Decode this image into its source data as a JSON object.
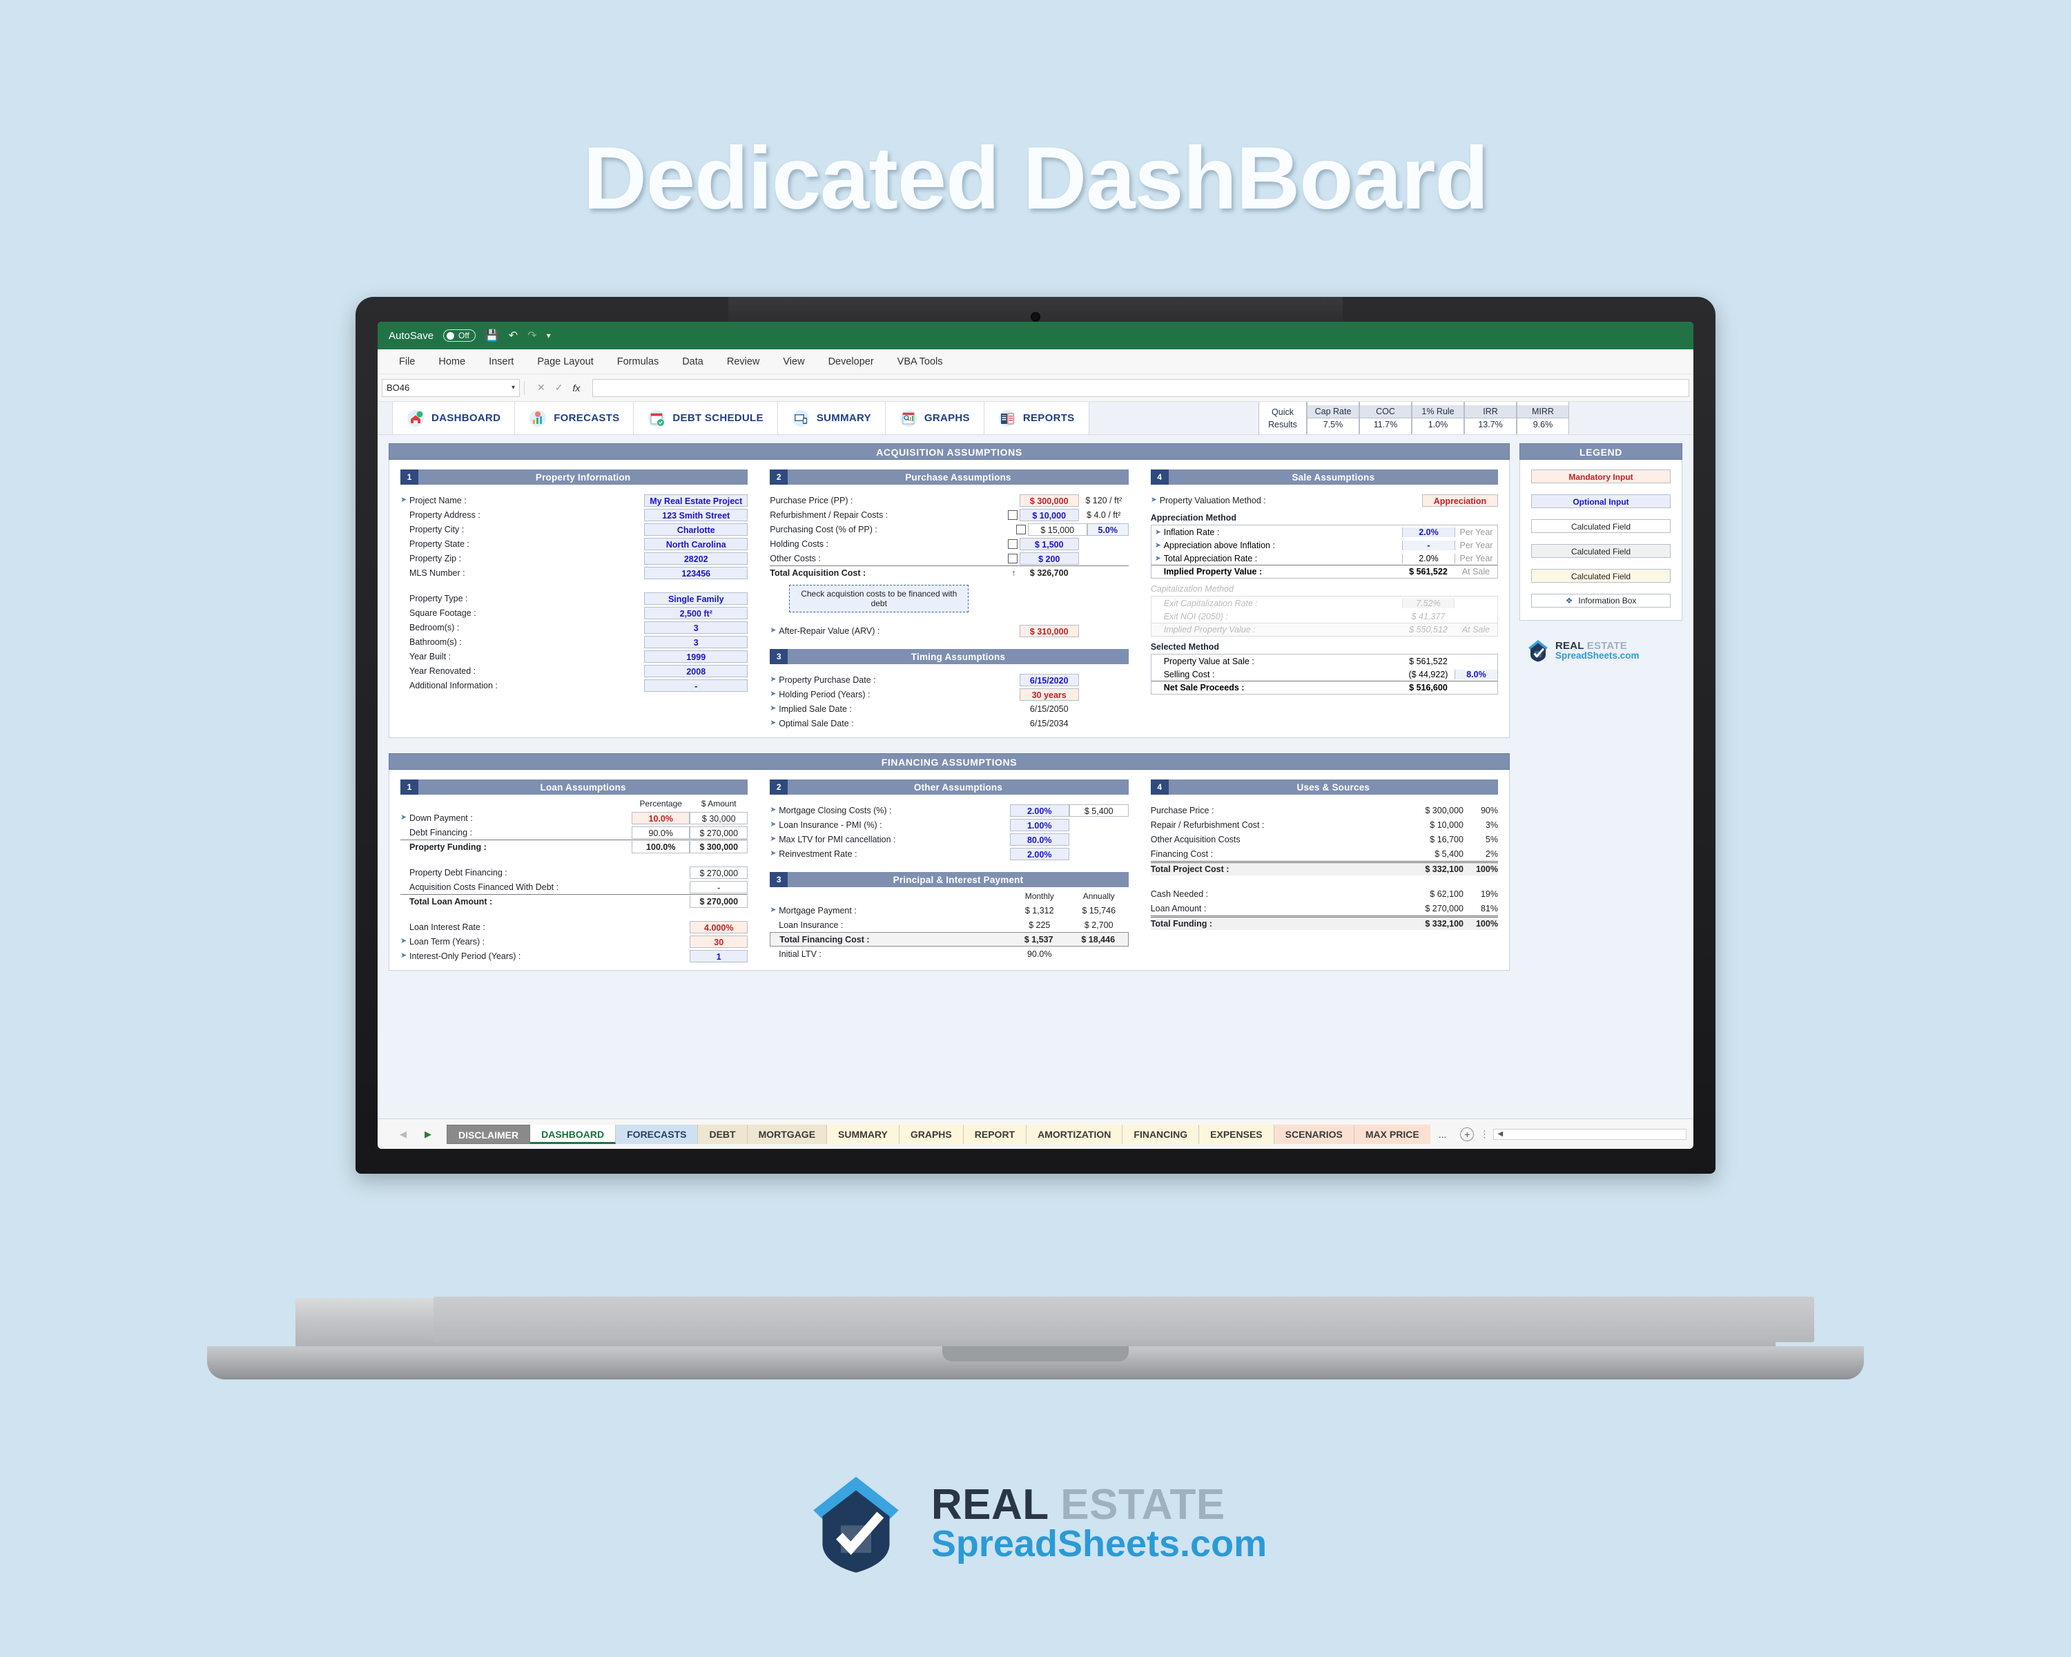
{
  "hero_title": "Dedicated DashBoard",
  "excel": {
    "autosave_label": "AutoSave",
    "autosave_state": "Off",
    "ribbon_tabs": [
      "File",
      "Home",
      "Insert",
      "Page Layout",
      "Formulas",
      "Data",
      "Review",
      "View",
      "Developer",
      "VBA Tools"
    ],
    "name_box": "BO46",
    "formula_bar": "",
    "nav_buttons": [
      {
        "label": "DASHBOARD",
        "icon": "house-chart-icon"
      },
      {
        "label": "FORECASTS",
        "icon": "bar-chart-person-icon"
      },
      {
        "label": "DEBT SCHEDULE",
        "icon": "calendar-check-icon"
      },
      {
        "label": "SUMMARY",
        "icon": "monitor-mobile-icon"
      },
      {
        "label": "GRAPHS",
        "icon": "magnify-chart-icon"
      },
      {
        "label": "REPORTS",
        "icon": "report-clipboard-icon"
      }
    ],
    "quick_results": {
      "label_line1": "Quick",
      "label_line2": "Results",
      "metrics": [
        {
          "name": "Cap Rate",
          "value": "7.5%"
        },
        {
          "name": "COC",
          "value": "11.7%"
        },
        {
          "name": "1% Rule",
          "value": "1.0%"
        },
        {
          "name": "IRR",
          "value": "13.7%"
        },
        {
          "name": "MIRR",
          "value": "9.6%"
        }
      ]
    },
    "sheet_tabs": [
      {
        "label": "DISCLAIMER",
        "style": "dis"
      },
      {
        "label": "DASHBOARD",
        "style": "active"
      },
      {
        "label": "FORECASTS",
        "style": "blue"
      },
      {
        "label": "DEBT",
        "style": "tan"
      },
      {
        "label": "MORTGAGE",
        "style": "tan"
      },
      {
        "label": "SUMMARY",
        "style": "cream"
      },
      {
        "label": "GRAPHS",
        "style": "cream"
      },
      {
        "label": "REPORT",
        "style": "cream"
      },
      {
        "label": "AMORTIZATION",
        "style": "cream"
      },
      {
        "label": "FINANCING",
        "style": "cream"
      },
      {
        "label": "EXPENSES",
        "style": "cream"
      },
      {
        "label": "SCENARIOS",
        "style": "peach"
      },
      {
        "label": "MAX PRICE",
        "style": "peach"
      }
    ],
    "tabs_more": "..."
  },
  "acquisition": {
    "band_title": "ACQUISITION ASSUMPTIONS",
    "property_information": {
      "num": "1",
      "title": "Property Information",
      "rows": [
        {
          "label": "Project Name :",
          "value": "My Real Estate Project",
          "style": "opt",
          "bullet": true
        },
        {
          "label": "Property Address :",
          "value": "123 Smith Street",
          "style": "opt",
          "bullet": false
        },
        {
          "label": "Property City :",
          "value": "Charlotte",
          "style": "opt",
          "bullet": false
        },
        {
          "label": "Property State :",
          "value": "North Carolina",
          "style": "opt",
          "bullet": false
        },
        {
          "label": "Property Zip :",
          "value": "28202",
          "style": "opt",
          "bullet": false
        },
        {
          "label": "MLS Number :",
          "value": "123456",
          "style": "opt",
          "bullet": false
        }
      ],
      "rows2": [
        {
          "label": "Property Type :",
          "value": "Single Family",
          "style": "opt"
        },
        {
          "label": "Square Footage :",
          "value": "2,500 ft²",
          "style": "opt"
        },
        {
          "label": "Bedroom(s) :",
          "value": "3",
          "style": "opt"
        },
        {
          "label": "Bathroom(s) :",
          "value": "3",
          "style": "opt"
        },
        {
          "label": "Year Built :",
          "value": "1999",
          "style": "opt"
        },
        {
          "label": "Year Renovated :",
          "value": "2008",
          "style": "opt"
        },
        {
          "label": "Additional Information :",
          "value": "-",
          "style": "opt"
        }
      ]
    },
    "purchase_assumptions": {
      "num": "2",
      "title": "Purchase Assumptions",
      "rows": [
        {
          "label": "Purchase Price (PP) :",
          "checkbox": false,
          "value": "$ 300,000",
          "style": "mand",
          "extra": "$ 120 / ft²",
          "extra_style": "plain"
        },
        {
          "label": "Refurbishment / Repair Costs :",
          "checkbox": true,
          "value": "$ 10,000",
          "style": "opt",
          "extra": "$ 4.0 / ft²",
          "extra_style": "plain"
        },
        {
          "label": "Purchasing Cost (% of PP) :",
          "checkbox": true,
          "value": "$ 15,000",
          "style": "calc-w",
          "extra": "5.0%",
          "extra_style": "opt-light"
        },
        {
          "label": "Holding Costs :",
          "checkbox": true,
          "value": "$ 1,500",
          "style": "opt",
          "extra": "",
          "extra_style": "plain"
        },
        {
          "label": "Other Costs :",
          "checkbox": true,
          "value": "$ 200",
          "style": "opt",
          "extra": "",
          "extra_style": "plain"
        }
      ],
      "total_label": "Total Acquisition Cost :",
      "total_arrow": "↑",
      "total_value": "$ 326,700",
      "note": "Check acquistion costs to be financed with debt",
      "arv_label": "After-Repair Value (ARV) :",
      "arv_value": "$ 310,000"
    },
    "timing_assumptions": {
      "num": "3",
      "title": "Timing Assumptions",
      "rows": [
        {
          "label": "Property Purchase Date :",
          "value": "6/15/2020",
          "style": "opt"
        },
        {
          "label": "Holding Period (Years) :",
          "value": "30 years",
          "style": "mand"
        },
        {
          "label": "Implied Sale Date :",
          "value": "6/15/2050",
          "style": "plain"
        },
        {
          "label": "Optimal Sale Date :",
          "value": "6/15/2034",
          "style": "plain"
        }
      ]
    },
    "sale_assumptions": {
      "num": "4",
      "title": "Sale Assumptions",
      "valuation_label": "Property Valuation Method :",
      "valuation_value": "Appreciation",
      "appreciation_header": "Appreciation Method",
      "appreciation_rows": [
        {
          "label": "Inflation Rate :",
          "value": "2.0%",
          "style": "opt",
          "unit": "Per Year"
        },
        {
          "label": "Appreciation above Inflation :",
          "value": "-",
          "style": "opt-light",
          "unit": "Per Year"
        },
        {
          "label": "Total Appreciation Rate :",
          "value": "2.0%",
          "style": "calc-w",
          "unit": "Per Year"
        }
      ],
      "implied_label": "Implied Property Value :",
      "implied_value": "$ 561,522",
      "implied_unit": "At Sale",
      "cap_header": "Capitalization Method",
      "cap_rows": [
        {
          "label": "Exit Capitalization Rate :",
          "value": "7.52%",
          "unit": ""
        },
        {
          "label": "Exit NOI (2050) :",
          "value": "$ 41,377",
          "unit": ""
        }
      ],
      "cap_implied_label": "Implied Property Value :",
      "cap_implied_value": "$ 550,512",
      "cap_implied_unit": "At Sale",
      "selected_header": "Selected Method",
      "selected_rows": [
        {
          "label": "Property Value at Sale :",
          "value": "$ 561,522",
          "extra": ""
        },
        {
          "label": "Selling Cost :",
          "value": "($ 44,922)",
          "extra": "8.0%"
        }
      ],
      "net_label": "Net Sale Proceeds :",
      "net_value": "$ 516,600"
    }
  },
  "financing": {
    "band_title": "FINANCING ASSUMPTIONS",
    "loan_assumptions": {
      "num": "1",
      "title": "Loan Assumptions",
      "col_pct": "Percentage",
      "col_amt": "$ Amount",
      "rows": [
        {
          "label": "Down Payment :",
          "pct": "10.0%",
          "amt": "$ 30,000",
          "pct_style": "mand",
          "bullet": true
        },
        {
          "label": "Debt Financing :",
          "pct": "90.0%",
          "amt": "$ 270,000",
          "pct_style": "calc-w",
          "bullet": false
        }
      ],
      "total_label": "Property Funding :",
      "total_pct": "100.0%",
      "total_amt": "$ 300,000",
      "rows2": [
        {
          "label": "Property Debt Financing :",
          "value": "$ 270,000"
        },
        {
          "label": "Acquisition Costs Financed With Debt :",
          "value": "-"
        }
      ],
      "total2_label": "Total Loan Amount :",
      "total2_value": "$ 270,000",
      "rows3": [
        {
          "label": "Loan Interest Rate :",
          "value": "4.000%",
          "style": "mand",
          "bullet": false
        },
        {
          "label": "Loan Term (Years) :",
          "value": "30",
          "style": "mand",
          "bullet": true
        },
        {
          "label": "Interest-Only Period (Years) :",
          "value": "1",
          "style": "opt",
          "bullet": true
        }
      ]
    },
    "other_assumptions": {
      "num": "2",
      "title": "Other Assumptions",
      "rows": [
        {
          "label": "Mortgage Closing Costs (%) :",
          "value": "2.00%",
          "extra": "$ 5,400"
        },
        {
          "label": "Loan Insurance - PMI (%) :",
          "value": "1.00%",
          "extra": ""
        },
        {
          "label": "Max LTV for PMI cancellation :",
          "value": "80.0%",
          "extra": ""
        },
        {
          "label": "Reinvestment Rate :",
          "value": "2.00%",
          "extra": ""
        }
      ]
    },
    "principal_interest": {
      "num": "3",
      "title": "Principal & Interest Payment",
      "col_monthly": "Monthly",
      "col_annually": "Annually",
      "rows": [
        {
          "label": "Mortgage Payment :",
          "monthly": "$ 1,312",
          "annually": "$ 15,746",
          "bullet": true
        },
        {
          "label": "Loan Insurance :",
          "monthly": "$ 225",
          "annually": "$ 2,700",
          "bullet": false
        }
      ],
      "total_label": "Total Financing Cost :",
      "total_monthly": "$ 1,537",
      "total_annually": "$ 18,446",
      "ltv_label": "Initial LTV :",
      "ltv_value": "90.0%"
    },
    "uses_sources": {
      "num": "4",
      "title": "Uses & Sources",
      "rows": [
        {
          "label": "Purchase Price :",
          "value": "$ 300,000",
          "pct": "90%"
        },
        {
          "label": "Repair / Refurbishment Cost :",
          "value": "$ 10,000",
          "pct": "3%"
        },
        {
          "label": "Other Acquisition Costs",
          "value": "$ 16,700",
          "pct": "5%"
        },
        {
          "label": "Financing Cost :",
          "value": "$ 5,400",
          "pct": "2%"
        }
      ],
      "total_label": "Total Project Cost :",
      "total_value": "$ 332,100",
      "total_pct": "100%",
      "rows2": [
        {
          "label": "Cash Needed :",
          "value": "$ 62,100",
          "pct": "19%"
        },
        {
          "label": "Loan Amount :",
          "value": "$ 270,000",
          "pct": "81%"
        }
      ],
      "total2_label": "Total Funding :",
      "total2_value": "$ 332,100",
      "total2_pct": "100%"
    }
  },
  "legend": {
    "title": "LEGEND",
    "items": [
      {
        "label": "Mandatory Input",
        "style": "mand"
      },
      {
        "label": "Optional Input",
        "style": "opt"
      },
      {
        "label": "Calculated Field",
        "style": "calc-w"
      },
      {
        "label": "Calculated Field",
        "style": "calc-g"
      },
      {
        "label": "Calculated Field",
        "style": "calc-y"
      },
      {
        "label": "Information Box",
        "style": "calc-w",
        "icon": "info-diamond-icon"
      }
    ],
    "logo_line1": "REAL",
    "logo_line1b": "ESTATE",
    "logo_line2": "SpreadSheets.com"
  },
  "brand": {
    "line1": "REAL",
    "line1b": "ESTATE",
    "line2": "SpreadSheets.com"
  },
  "colors": {
    "excel_green": "#217346",
    "band_blue": "#7e8fb0",
    "num_blue": "#2f4a7d",
    "accent": "#2b9ad6"
  }
}
